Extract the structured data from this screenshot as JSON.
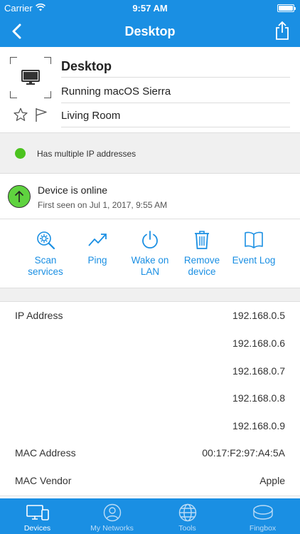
{
  "status_bar": {
    "carrier": "Carrier",
    "time": "9:57 AM",
    "icons": [
      "wifi-icon",
      "battery-icon"
    ]
  },
  "nav": {
    "title": "Desktop",
    "back_icon": "chevron-left-icon",
    "share_icon": "share-icon"
  },
  "device": {
    "name": "Desktop",
    "os": "Running macOS Sierra",
    "location": "Living Room",
    "icon": "monitor-icon"
  },
  "alert": {
    "text": "Has multiple IP addresses",
    "color": "#4cc31f"
  },
  "status": {
    "title": "Device is online",
    "subtitle": "First seen on Jul 1, 2017, 9:55 AM",
    "color": "#5fd33f"
  },
  "actions": [
    {
      "label_line1": "Scan",
      "label_line2": "services",
      "icon": "scan-services-icon"
    },
    {
      "label_line1": "Ping",
      "label_line2": "",
      "icon": "ping-icon"
    },
    {
      "label_line1": "Wake on",
      "label_line2": "LAN",
      "icon": "power-icon"
    },
    {
      "label_line1": "Remove",
      "label_line2": "device",
      "icon": "trash-icon"
    },
    {
      "label_line1": "Event Log",
      "label_line2": "",
      "icon": "book-icon"
    }
  ],
  "details": {
    "ip_label": "IP Address",
    "ip_addresses": [
      "192.168.0.5",
      "192.168.0.6",
      "192.168.0.7",
      "192.168.0.8",
      "192.168.0.9"
    ],
    "mac_label": "MAC Address",
    "mac_value": "00:17:F2:97:A4:5A",
    "vendor_label": "MAC Vendor",
    "vendor_value": "Apple"
  },
  "tabs": [
    {
      "label": "Devices",
      "icon": "devices-icon",
      "active": true
    },
    {
      "label": "My Networks",
      "icon": "user-icon",
      "active": false
    },
    {
      "label": "Tools",
      "icon": "globe-icon",
      "active": false
    },
    {
      "label": "Fingbox",
      "icon": "fingbox-icon",
      "active": false
    }
  ],
  "colors": {
    "accent": "#1a8fe3",
    "tab_inactive": "#bcdcf6"
  }
}
